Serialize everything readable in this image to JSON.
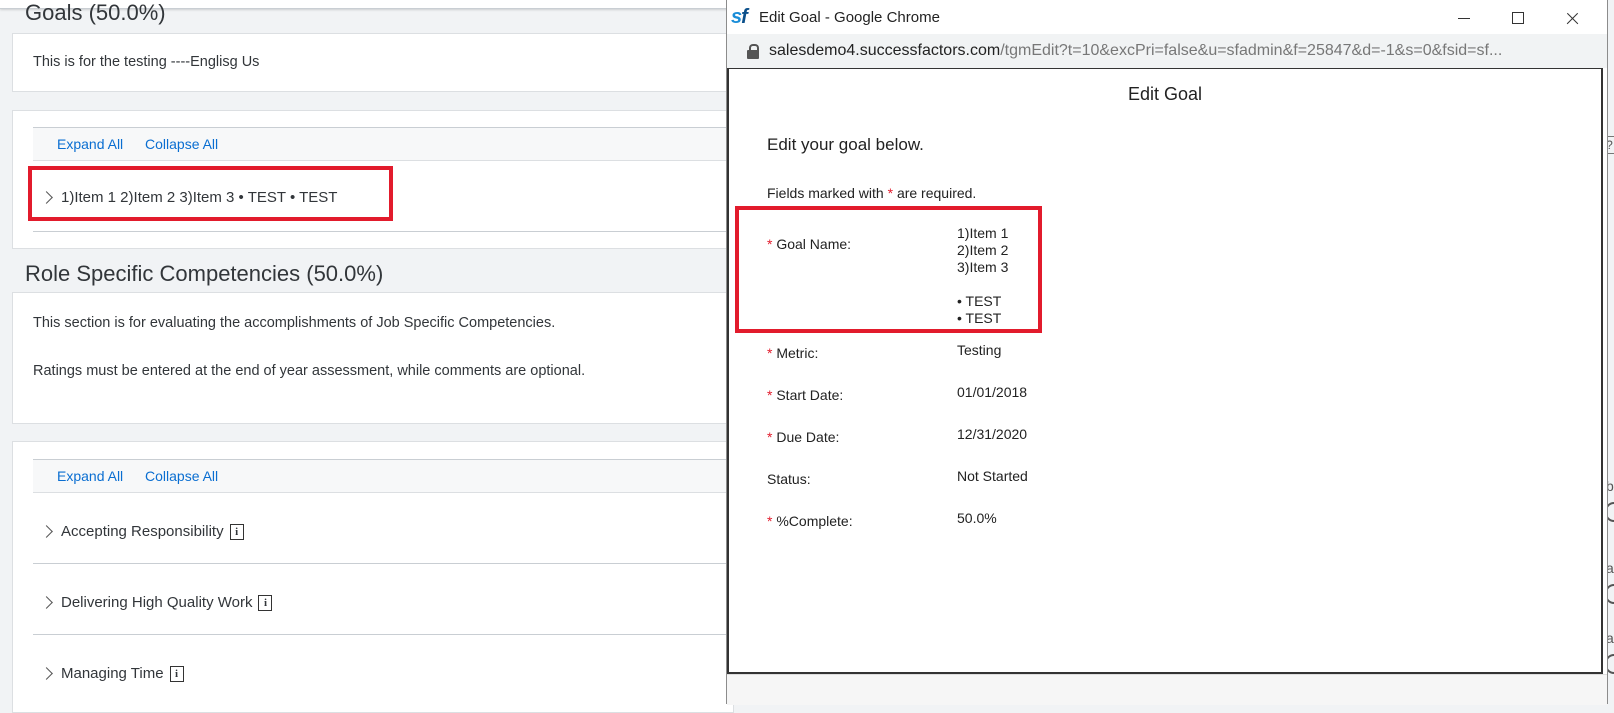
{
  "background": {
    "goals_section": {
      "title": "Goals (50.0%)",
      "description": "This is for the testing ----Englisg Us",
      "expand_all": "Expand All",
      "collapse_all": "Collapse All",
      "goal_row": "1)Item 1 2)Item 2 3)Item 3 • TEST • TEST"
    },
    "competencies_section": {
      "title": "Role Specific Competencies (50.0%)",
      "description_line1": "This section is for evaluating the accomplishments of Job Specific Competencies.",
      "description_line2": "Ratings must be entered at the end of year assessment, while comments are optional.",
      "expand_all": "Expand All",
      "collapse_all": "Collapse All",
      "items": [
        {
          "label": "Accepting Responsibility"
        },
        {
          "label": "Delivering High Quality Work"
        },
        {
          "label": "Managing Time"
        }
      ]
    },
    "right_edge_fragments": [
      "?",
      "b",
      "a",
      "a"
    ]
  },
  "popup": {
    "window_title": "Edit Goal - Google Chrome",
    "url_host": "salesdemo4.successfactors.com",
    "url_path": "/tgmEdit?t=10&excPri=false&u=sfadmin&f=25847&d=-1&s=0&fsid=sf...",
    "dialog_title": "Edit Goal",
    "intro": "Edit your goal below.",
    "required_note_pre": "Fields marked with",
    "required_marker": "*",
    "required_note_post": "are required.",
    "fields": {
      "goal_name": {
        "label": "Goal Name:",
        "lines": [
          "1)Item 1",
          "2)Item 2",
          "3)Item 3",
          "",
          "• TEST",
          "• TEST"
        ]
      },
      "metric": {
        "label": "Metric:",
        "value": "Testing"
      },
      "start_date": {
        "label": "Start Date:",
        "value": "01/01/2018"
      },
      "due_date": {
        "label": "Due Date:",
        "value": "12/31/2020"
      },
      "status": {
        "label": "Status:",
        "value": "Not Started"
      },
      "percent_complete": {
        "label": "%Complete:",
        "value": "50.0%"
      }
    }
  },
  "colors": {
    "link": "#0a6ed1",
    "highlight_box": "#e21b2c",
    "required_marker": "#e21b2c",
    "sf_logo": "#1a8dd8"
  }
}
